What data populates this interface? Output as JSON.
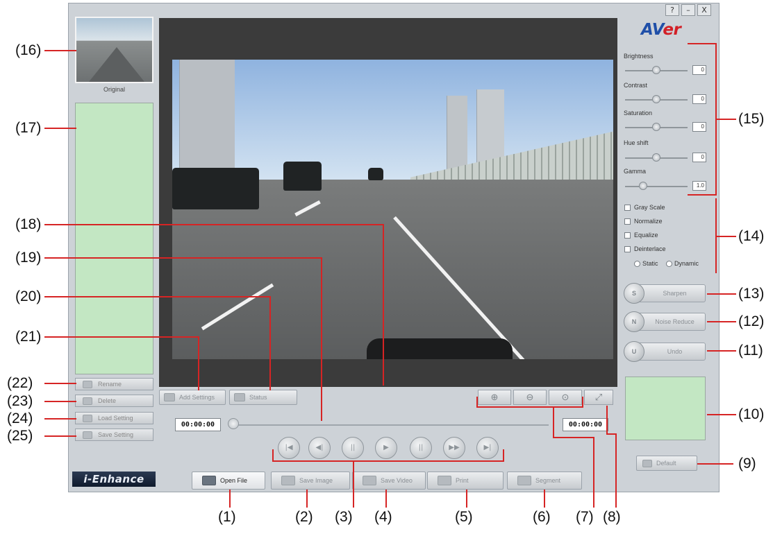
{
  "window": {
    "help_btn": "?",
    "min_btn": "–",
    "close_btn": "X"
  },
  "left_panel": {
    "thumbnail_label": "Original",
    "buttons": [
      {
        "label": "Rename"
      },
      {
        "label": "Delete"
      },
      {
        "label": "Load Setting"
      },
      {
        "label": "Save Setting"
      }
    ],
    "brand": "i-Enhance"
  },
  "video_controls": {
    "add_settings": "Add Settings",
    "status": "Status",
    "time_start": "00:00:00",
    "time_end": "00:00:00",
    "playback": [
      "|◀",
      "◀|",
      "||",
      "▶",
      "||",
      "▶▶",
      "▶|"
    ],
    "zoom": [
      "⊕",
      "⊖",
      "⊙",
      "⤢"
    ]
  },
  "bottom_toolbar": {
    "open_file": "Open File",
    "save_image": "Save Image",
    "save_video": "Save Video",
    "print": "Print",
    "segment": "Segment"
  },
  "right_panel": {
    "logo_a": "AV",
    "logo_b": "er",
    "sliders": [
      {
        "label": "Brightness",
        "value": "0",
        "level": 0.5
      },
      {
        "label": "Contrast",
        "value": "0",
        "level": 0.5
      },
      {
        "label": "Saturation",
        "value": "0",
        "level": 0.5
      },
      {
        "label": "Hue shift",
        "value": "0",
        "level": 0.5
      },
      {
        "label": "Gamma",
        "value": "1.0",
        "level": 0.25
      }
    ],
    "checkboxes": [
      "Gray Scale",
      "Normalize",
      "Equalize",
      "Deinterlace"
    ],
    "radios": [
      "Static",
      "Dynamic"
    ],
    "actions": [
      {
        "label": "Sharpen",
        "badge": "S"
      },
      {
        "label": "Noise Reduce",
        "badge": "N"
      },
      {
        "label": "Undo",
        "badge": "U"
      }
    ],
    "default_btn": "Default"
  },
  "callouts": {
    "c1": "(1)",
    "c2": "(2)",
    "c3": "(3)",
    "c4": "(4)",
    "c5": "(5)",
    "c6": "(6)",
    "c7": "(7)",
    "c8": "(8)",
    "c9": "(9)",
    "c10": "(10)",
    "c11": "(11)",
    "c12": "(12)",
    "c13": "(13)",
    "c14": "(14)",
    "c15": "(15)",
    "c16": "(16)",
    "c17": "(17)",
    "c18": "(18)",
    "c19": "(19)",
    "c20": "(20)",
    "c21": "(21)",
    "c22": "(22)",
    "c23": "(23)",
    "c24": "(24)",
    "c25": "(25)"
  },
  "colors": {
    "annotation_line": "#d62424",
    "list_background": "#c3e7c3",
    "window_background": "#cdd2d7",
    "logo_blue": "#1f4fa8",
    "logo_red": "#d21f26"
  }
}
